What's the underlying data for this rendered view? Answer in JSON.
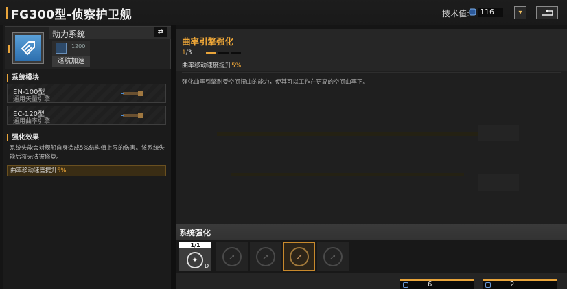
{
  "header": {
    "title": "FG300型-侦察护卫舰",
    "tech_label": "技术值:",
    "tech_value": "116"
  },
  "system": {
    "name": "动力系统",
    "skill_num": "1200",
    "skill_name": "巡航加速"
  },
  "modules_section": {
    "title": "系统模块",
    "modules": [
      {
        "name": "EN-100型",
        "desc": "通用矢量引擎"
      },
      {
        "name": "EC-120型",
        "desc": "通用曲率引擎"
      }
    ]
  },
  "effect_section": {
    "title": "强化效果",
    "text": "系统失能会对舰船自身造成5%结构值上限的伤害。该系统失能后将无法被修复。",
    "bar_text": "曲率移动速度提升",
    "bar_value": "5%"
  },
  "detail": {
    "title": "曲率引擎强化",
    "level_current": "1",
    "level_total": "/3",
    "effect_text": "曲率移动速度提升",
    "effect_value": "5%",
    "description": "强化曲率引擎耐受空间扭曲的能力，使其可以工作在更高的空间曲率下。"
  },
  "enhance": {
    "title": "系统强化",
    "current_count": "1/1",
    "current_grade": "D",
    "costs": [
      "6",
      "2"
    ]
  },
  "colors": {
    "accent": "#e8a43a",
    "highlight": "#f0a838"
  }
}
